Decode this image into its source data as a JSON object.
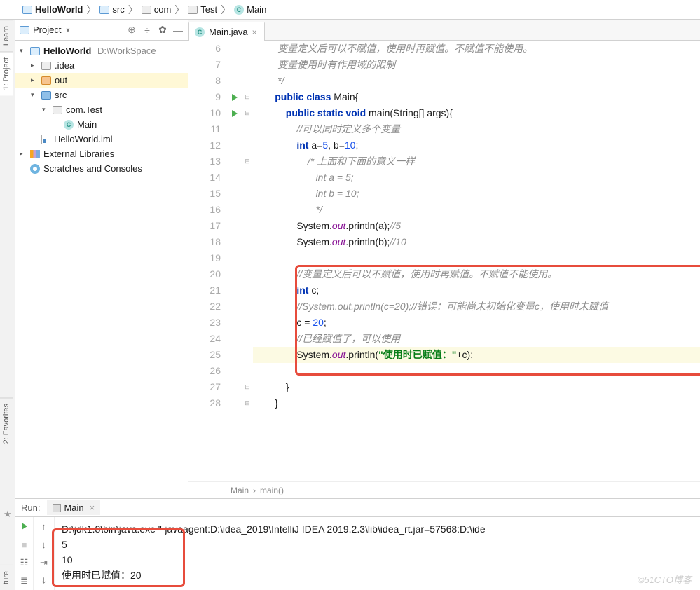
{
  "breadcrumb": [
    {
      "label": "HelloWorld",
      "bold": true,
      "icon": "folder"
    },
    {
      "label": "src",
      "icon": "folder"
    },
    {
      "label": "com",
      "icon": "folder-gray"
    },
    {
      "label": "Test",
      "icon": "folder-gray"
    },
    {
      "label": "Main",
      "icon": "c"
    }
  ],
  "leftTabs": {
    "learn": "Learn",
    "project": "1: Project",
    "favorites": "2: Favorites",
    "structure": "ture"
  },
  "projectPanel": {
    "label": "Project"
  },
  "editorTab": {
    "label": "Main.java"
  },
  "tree": [
    {
      "pad": "p0",
      "arrow": "▾",
      "icon": "folder",
      "label": "HelloWorld",
      "extra": "D:\\WorkSpace",
      "bold": true
    },
    {
      "pad": "p1",
      "arrow": "▸",
      "icon": "folder-gray",
      "label": ".idea"
    },
    {
      "pad": "p1",
      "arrow": "▸",
      "icon": "folder-orange",
      "label": "out",
      "sel": true
    },
    {
      "pad": "p1",
      "arrow": "▾",
      "icon": "folder-blue2",
      "label": "src"
    },
    {
      "pad": "p2",
      "arrow": "▾",
      "icon": "folder-gray",
      "label": "com.Test"
    },
    {
      "pad": "p3",
      "arrow": "",
      "icon": "c",
      "label": "Main"
    },
    {
      "pad": "p1",
      "arrow": "",
      "icon": "iml",
      "label": "HelloWorld.iml"
    },
    {
      "pad": "p0",
      "arrow": "▸",
      "icon": "lib",
      "label": "External Libraries"
    },
    {
      "pad": "p0",
      "arrow": "",
      "icon": "scratch",
      "label": "Scratches and Consoles"
    }
  ],
  "code": {
    "start": 6,
    "lines": [
      {
        "t": "com",
        "txt": "        变量定义后可以不赋值，使用时再赋值。不赋值不能使用。"
      },
      {
        "t": "com",
        "txt": "        变量使用时有作用域的限制"
      },
      {
        "t": "com",
        "txt": "        */"
      },
      {
        "html": "       <span class='kw'>public class</span> Main{",
        "run": true,
        "fold": "⊟"
      },
      {
        "html": "           <span class='kw'>public static void</span> main(String[] args){",
        "run": true,
        "fold": "⊟"
      },
      {
        "html": "               <span class='com'>//可以同时定义多个变量</span>"
      },
      {
        "html": "               <span class='kw'>int</span> a=<span class='num'>5</span>, b=<span class='num'>10</span>;"
      },
      {
        "html": "                   <span class='com'>/* 上面和下面的意义一样</span>",
        "fold": "⊟"
      },
      {
        "html": "                   <span class='com'>   int a = 5;</span>"
      },
      {
        "html": "                   <span class='com'>   int b = 10;</span>"
      },
      {
        "html": "                   <span class='com'>   */</span>"
      },
      {
        "html": "               System.<span class='fld'>out</span>.println(a);<span class='com'>//5</span>"
      },
      {
        "html": "               System.<span class='fld'>out</span>.println(b);<span class='com'>//10</span>"
      },
      {
        "html": ""
      },
      {
        "html": "               <span class='com'>//变量定义后可以不赋值，使用时再赋值。不赋值不能使用。</span>"
      },
      {
        "html": "               <span class='kw'>int</span> c;"
      },
      {
        "html": "               <span class='com'>//System.out.println(c=20);//错误：可能尚未初始化变量c，使用时未赋值</span>"
      },
      {
        "html": "               c = <span class='num'>20</span>;"
      },
      {
        "html": "               <span class='com'>//已经赋值了，可以使用</span>"
      },
      {
        "html": "               System.<span class='fld'>out</span>.println(<span class='str'>\"使用时已赋值：\"</span>+c);",
        "hl": true
      },
      {
        "html": ""
      },
      {
        "html": "           }",
        "fold": "⊟"
      },
      {
        "html": "       }",
        "fold": "⊟"
      }
    ]
  },
  "breadcrumb2": {
    "a": "Main",
    "b": "main()"
  },
  "run": {
    "title": "Run:",
    "tab": "Main",
    "cmd": "D:\\jdk1.8\\bin\\java.exe \"-javaagent:D:\\idea_2019\\IntelliJ IDEA 2019.2.3\\lib\\idea_rt.jar=57568:D:\\ide",
    "out": [
      "5",
      "10",
      "使用时已赋值：20"
    ]
  },
  "watermark": "©51CTO博客"
}
